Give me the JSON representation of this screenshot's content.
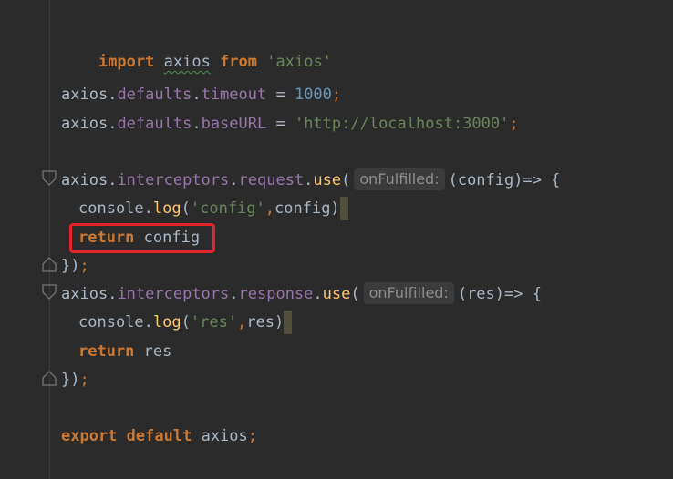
{
  "editor": {
    "colors": {
      "background": "#2b2b2b",
      "keyword": "#cc7832",
      "property": "#9876aa",
      "function": "#ffc66d",
      "number": "#6897bb",
      "string": "#6a8759",
      "plain": "#a9b7c6",
      "highlight_box": "#e0262b"
    },
    "lines": {
      "l1": {
        "kw1": "import",
        "id": "axios",
        "kw2": "from",
        "str": "'axios'"
      },
      "l2": {
        "obj": "axios",
        "dot1": ".",
        "p1": "defaults",
        "dot2": ".",
        "p2": "timeout",
        "op": " = ",
        "num": "1000",
        "semi": ";"
      },
      "l3": {
        "obj": "axios",
        "dot1": ".",
        "p1": "defaults",
        "dot2": ".",
        "p2": "baseURL",
        "op": " = ",
        "str": "'http://localhost:3000'",
        "semi": ";"
      },
      "l4": {
        "obj": "axios",
        "dot1": ".",
        "p1": "interceptors",
        "dot2": ".",
        "p2": "request",
        "dot3": ".",
        "fn": "use",
        "open": "(",
        "hint": "onFulfilled:",
        "rest": "(config)=> {"
      },
      "l5": {
        "obj": "console",
        "dot": ".",
        "fn": "log",
        "open": "(",
        "str": "'config'",
        "comma": ",",
        "rest": "config)"
      },
      "l6": {
        "kw": "return",
        "rest": " config"
      },
      "l7": {
        "close": "})",
        "semi": ";"
      },
      "l8": {
        "obj": "axios",
        "dot1": ".",
        "p1": "interceptors",
        "dot2": ".",
        "p2": "response",
        "dot3": ".",
        "fn": "use",
        "open": "(",
        "hint": "onFulfilled:",
        "rest": "(res)=> {"
      },
      "l9": {
        "obj": "console",
        "dot": ".",
        "fn": "log",
        "open": "(",
        "str": "'res'",
        "comma": ",",
        "rest": "res)"
      },
      "l10": {
        "kw": "return",
        "rest": " res"
      },
      "l11": {
        "close": "})",
        "semi": ";"
      },
      "l12": {
        "kw1": "export",
        "kw2": "default",
        "id": "axios",
        "semi": ";"
      }
    }
  }
}
